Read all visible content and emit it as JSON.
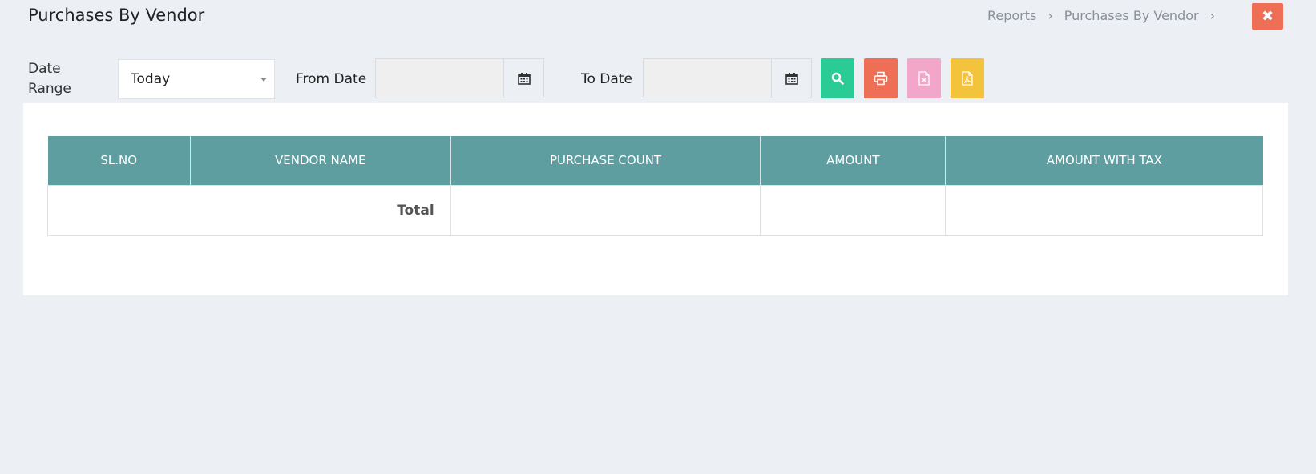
{
  "header": {
    "title": "Purchases By Vendor",
    "breadcrumb": [
      "Reports",
      "Purchases By Vendor"
    ]
  },
  "filters": {
    "date_range_label": "Date Range",
    "date_range_value": "Today",
    "from_label": "From Date",
    "from_value": "",
    "to_label": "To Date",
    "to_value": ""
  },
  "actions": {
    "icons": [
      "search-icon",
      "print-icon",
      "excel-file-icon",
      "pdf-file-icon"
    ],
    "colors": {
      "search": "#2bcb95",
      "print": "#ee6f55",
      "excel": "#f2a6c9",
      "pdf": "#f3c33c",
      "close": "#ee6f55"
    }
  },
  "table": {
    "header_color": "#5f9ea0",
    "columns": [
      "SL.NO",
      "VENDOR NAME",
      "PURCHASE COUNT",
      "AMOUNT",
      "AMOUNT WITH TAX"
    ],
    "footer": {
      "label": "Total",
      "purchase_count": "",
      "amount": "",
      "amount_with_tax": ""
    }
  }
}
